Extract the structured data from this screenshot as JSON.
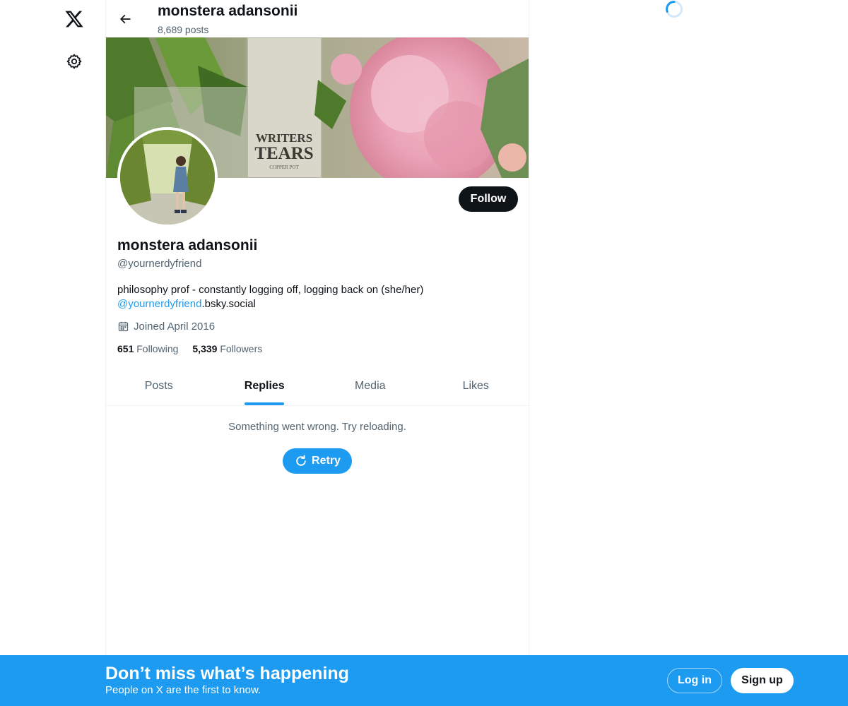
{
  "nav": {
    "logo_icon": "x-logo-icon",
    "settings_icon": "gear-icon"
  },
  "header": {
    "title": "monstera adansonii",
    "posts_count": "8,689 posts",
    "back_icon": "arrow-left-icon"
  },
  "profile": {
    "name": "monstera adansonii",
    "handle": "@yournerdyfriend",
    "bio_line1": "philosophy prof - constantly logging off, logging back on (she/her)",
    "bio_link": "@yournerdyfriend",
    "bio_link_suffix": ".bsky.social",
    "joined": "Joined April 2016",
    "following_count": "651",
    "following_label": "Following",
    "followers_count": "5,339",
    "followers_label": "Followers",
    "follow_label": "Follow",
    "banner_bottle_text_1": "WRITERS",
    "banner_bottle_text_2": "TEARS",
    "banner_bottle_text_3": "COPPER POT"
  },
  "tabs": [
    {
      "label": "Posts",
      "active": false
    },
    {
      "label": "Replies",
      "active": true
    },
    {
      "label": "Media",
      "active": false
    },
    {
      "label": "Likes",
      "active": false
    }
  ],
  "feed": {
    "error_message": "Something went wrong. Try reloading.",
    "retry_label": "Retry"
  },
  "bottom_banner": {
    "title": "Don’t miss what’s happening",
    "subtitle": "People on X are the first to know.",
    "login_label": "Log in",
    "signup_label": "Sign up"
  },
  "colors": {
    "accent": "#1d9bf0",
    "text_primary": "#0f1419",
    "text_secondary": "#536471",
    "border": "#eff3f4"
  }
}
